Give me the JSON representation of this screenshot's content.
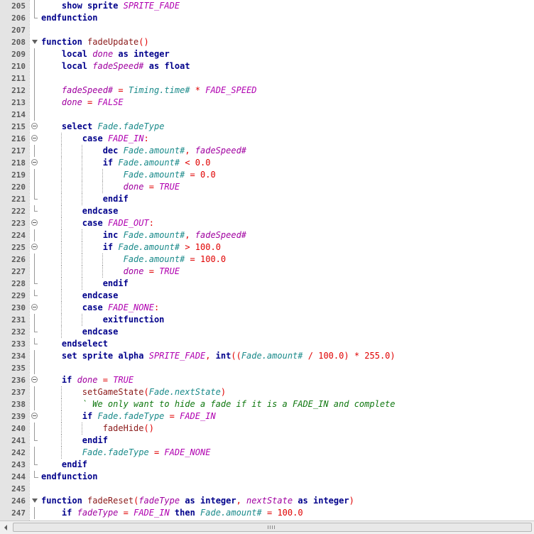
{
  "editor": {
    "lines": [
      {
        "n": "205",
        "fold": "vl",
        "guides": [],
        "code": [
          [
            "    ",
            ""
          ],
          [
            "show sprite",
            "kw"
          ],
          [
            " ",
            ""
          ],
          [
            "SPRITE_FADE",
            "cs"
          ]
        ]
      },
      {
        "n": "206",
        "fold": "end",
        "guides": [],
        "code": [
          [
            "endfunction",
            "kw"
          ]
        ]
      },
      {
        "n": "207",
        "fold": "",
        "guides": [],
        "code": []
      },
      {
        "n": "208",
        "fold": "fn",
        "guides": [],
        "code": [
          [
            "function",
            "kw"
          ],
          [
            " ",
            ""
          ],
          [
            "fadeUpdate",
            "nm"
          ],
          [
            "()",
            "op"
          ]
        ]
      },
      {
        "n": "209",
        "fold": "vl",
        "guides": [],
        "code": [
          [
            "    ",
            ""
          ],
          [
            "local",
            "kw"
          ],
          [
            " ",
            ""
          ],
          [
            "done",
            "va"
          ],
          [
            " ",
            ""
          ],
          [
            "as",
            "kw"
          ],
          [
            " ",
            ""
          ],
          [
            "integer",
            "kw"
          ]
        ]
      },
      {
        "n": "210",
        "fold": "vl",
        "guides": [],
        "code": [
          [
            "    ",
            ""
          ],
          [
            "local",
            "kw"
          ],
          [
            " ",
            ""
          ],
          [
            "fadeSpeed#",
            "va"
          ],
          [
            " ",
            ""
          ],
          [
            "as",
            "kw"
          ],
          [
            " ",
            ""
          ],
          [
            "float",
            "kw"
          ]
        ]
      },
      {
        "n": "211",
        "fold": "vl",
        "guides": [],
        "code": []
      },
      {
        "n": "212",
        "fold": "vl",
        "guides": [],
        "code": [
          [
            "    ",
            ""
          ],
          [
            "fadeSpeed#",
            "va"
          ],
          [
            " ",
            ""
          ],
          [
            "=",
            "op"
          ],
          [
            " ",
            ""
          ],
          [
            "Timing.time#",
            "me"
          ],
          [
            " ",
            ""
          ],
          [
            "*",
            "op"
          ],
          [
            " ",
            ""
          ],
          [
            "FADE_SPEED",
            "cs"
          ]
        ]
      },
      {
        "n": "213",
        "fold": "vl",
        "guides": [],
        "code": [
          [
            "    ",
            ""
          ],
          [
            "done",
            "va"
          ],
          [
            " ",
            ""
          ],
          [
            "=",
            "op"
          ],
          [
            " ",
            ""
          ],
          [
            "FALSE",
            "cs"
          ]
        ]
      },
      {
        "n": "214",
        "fold": "vl",
        "guides": [],
        "code": []
      },
      {
        "n": "215",
        "fold": "box",
        "guides": [],
        "code": [
          [
            "    ",
            ""
          ],
          [
            "select",
            "kw"
          ],
          [
            " ",
            ""
          ],
          [
            "Fade.fadeType",
            "me"
          ]
        ]
      },
      {
        "n": "216",
        "fold": "box",
        "guides": [
          4
        ],
        "code": [
          [
            "        ",
            ""
          ],
          [
            "case",
            "kw"
          ],
          [
            " ",
            ""
          ],
          [
            "FADE_IN",
            "cs"
          ],
          [
            ":",
            "op"
          ]
        ]
      },
      {
        "n": "217",
        "fold": "vl",
        "guides": [
          4,
          8
        ],
        "code": [
          [
            "            ",
            ""
          ],
          [
            "dec",
            "kw"
          ],
          [
            " ",
            ""
          ],
          [
            "Fade.amount#",
            "me"
          ],
          [
            ", ",
            "op"
          ],
          [
            "fadeSpeed#",
            "va"
          ]
        ]
      },
      {
        "n": "218",
        "fold": "box",
        "guides": [
          4,
          8
        ],
        "code": [
          [
            "            ",
            ""
          ],
          [
            "if",
            "kw"
          ],
          [
            " ",
            ""
          ],
          [
            "Fade.amount#",
            "me"
          ],
          [
            " ",
            ""
          ],
          [
            "<",
            "op"
          ],
          [
            " ",
            ""
          ],
          [
            "0.0",
            "num"
          ]
        ]
      },
      {
        "n": "219",
        "fold": "vl",
        "guides": [
          4,
          8,
          12
        ],
        "code": [
          [
            "                ",
            ""
          ],
          [
            "Fade.amount#",
            "me"
          ],
          [
            " ",
            ""
          ],
          [
            "=",
            "op"
          ],
          [
            " ",
            ""
          ],
          [
            "0.0",
            "num"
          ]
        ]
      },
      {
        "n": "220",
        "fold": "vl",
        "guides": [
          4,
          8,
          12
        ],
        "code": [
          [
            "                ",
            ""
          ],
          [
            "done",
            "va"
          ],
          [
            " ",
            ""
          ],
          [
            "=",
            "op"
          ],
          [
            " ",
            ""
          ],
          [
            "TRUE",
            "cs"
          ]
        ]
      },
      {
        "n": "221",
        "fold": "end",
        "guides": [
          4,
          8
        ],
        "code": [
          [
            "            ",
            ""
          ],
          [
            "endif",
            "kw"
          ]
        ]
      },
      {
        "n": "222",
        "fold": "end",
        "guides": [
          4
        ],
        "code": [
          [
            "        ",
            ""
          ],
          [
            "endcase",
            "kw"
          ]
        ]
      },
      {
        "n": "223",
        "fold": "box",
        "guides": [
          4
        ],
        "code": [
          [
            "        ",
            ""
          ],
          [
            "case",
            "kw"
          ],
          [
            " ",
            ""
          ],
          [
            "FADE_OUT",
            "cs"
          ],
          [
            ":",
            "op"
          ]
        ]
      },
      {
        "n": "224",
        "fold": "vl",
        "guides": [
          4,
          8
        ],
        "code": [
          [
            "            ",
            ""
          ],
          [
            "inc",
            "kw"
          ],
          [
            " ",
            ""
          ],
          [
            "Fade.amount#",
            "me"
          ],
          [
            ", ",
            "op"
          ],
          [
            "fadeSpeed#",
            "va"
          ]
        ]
      },
      {
        "n": "225",
        "fold": "box",
        "guides": [
          4,
          8
        ],
        "code": [
          [
            "            ",
            ""
          ],
          [
            "if",
            "kw"
          ],
          [
            " ",
            ""
          ],
          [
            "Fade.amount#",
            "me"
          ],
          [
            " ",
            ""
          ],
          [
            ">",
            "op"
          ],
          [
            " ",
            ""
          ],
          [
            "100.0",
            "num"
          ]
        ]
      },
      {
        "n": "226",
        "fold": "vl",
        "guides": [
          4,
          8,
          12
        ],
        "code": [
          [
            "                ",
            ""
          ],
          [
            "Fade.amount#",
            "me"
          ],
          [
            " ",
            ""
          ],
          [
            "=",
            "op"
          ],
          [
            " ",
            ""
          ],
          [
            "100.0",
            "num"
          ]
        ]
      },
      {
        "n": "227",
        "fold": "vl",
        "guides": [
          4,
          8,
          12
        ],
        "code": [
          [
            "                ",
            ""
          ],
          [
            "done",
            "va"
          ],
          [
            " ",
            ""
          ],
          [
            "=",
            "op"
          ],
          [
            " ",
            ""
          ],
          [
            "TRUE",
            "cs"
          ]
        ]
      },
      {
        "n": "228",
        "fold": "end",
        "guides": [
          4,
          8
        ],
        "code": [
          [
            "            ",
            ""
          ],
          [
            "endif",
            "kw"
          ]
        ]
      },
      {
        "n": "229",
        "fold": "end",
        "guides": [
          4
        ],
        "code": [
          [
            "        ",
            ""
          ],
          [
            "endcase",
            "kw"
          ]
        ]
      },
      {
        "n": "230",
        "fold": "box",
        "guides": [
          4
        ],
        "code": [
          [
            "        ",
            ""
          ],
          [
            "case",
            "kw"
          ],
          [
            " ",
            ""
          ],
          [
            "FADE_NONE",
            "cs"
          ],
          [
            ":",
            "op"
          ]
        ]
      },
      {
        "n": "231",
        "fold": "vl",
        "guides": [
          4,
          8
        ],
        "code": [
          [
            "            ",
            ""
          ],
          [
            "exitfunction",
            "kw"
          ]
        ]
      },
      {
        "n": "232",
        "fold": "end",
        "guides": [
          4
        ],
        "code": [
          [
            "        ",
            ""
          ],
          [
            "endcase",
            "kw"
          ]
        ]
      },
      {
        "n": "233",
        "fold": "end",
        "guides": [],
        "code": [
          [
            "    ",
            ""
          ],
          [
            "endselect",
            "kw"
          ]
        ]
      },
      {
        "n": "234",
        "fold": "vl",
        "guides": [],
        "code": [
          [
            "    ",
            ""
          ],
          [
            "set sprite alpha",
            "kw"
          ],
          [
            " ",
            ""
          ],
          [
            "SPRITE_FADE",
            "cs"
          ],
          [
            ", ",
            "op"
          ],
          [
            "int",
            "kw"
          ],
          [
            "((",
            "op"
          ],
          [
            "Fade.amount#",
            "me"
          ],
          [
            " ",
            ""
          ],
          [
            "/",
            "op"
          ],
          [
            " ",
            ""
          ],
          [
            "100.0",
            "num"
          ],
          [
            ")",
            "op"
          ],
          [
            " ",
            ""
          ],
          [
            "*",
            "op"
          ],
          [
            " ",
            ""
          ],
          [
            "255.0",
            "num"
          ],
          [
            ")",
            "op"
          ]
        ]
      },
      {
        "n": "235",
        "fold": "vl",
        "guides": [],
        "code": []
      },
      {
        "n": "236",
        "fold": "box",
        "guides": [],
        "code": [
          [
            "    ",
            ""
          ],
          [
            "if",
            "kw"
          ],
          [
            " ",
            ""
          ],
          [
            "done",
            "va"
          ],
          [
            " ",
            ""
          ],
          [
            "=",
            "op"
          ],
          [
            " ",
            ""
          ],
          [
            "TRUE",
            "cs"
          ]
        ]
      },
      {
        "n": "237",
        "fold": "vl",
        "guides": [
          4
        ],
        "code": [
          [
            "        ",
            ""
          ],
          [
            "setGameState",
            "fn2"
          ],
          [
            "(",
            "op"
          ],
          [
            "Fade.nextState",
            "me"
          ],
          [
            ")",
            "op"
          ]
        ]
      },
      {
        "n": "238",
        "fold": "vl",
        "guides": [
          4
        ],
        "code": [
          [
            "        ",
            ""
          ],
          [
            "` We only want to hide a fade if it is a FADE_IN and complete",
            "cm"
          ]
        ]
      },
      {
        "n": "239",
        "fold": "box",
        "guides": [
          4
        ],
        "code": [
          [
            "        ",
            ""
          ],
          [
            "if",
            "kw"
          ],
          [
            " ",
            ""
          ],
          [
            "Fade.fadeType",
            "me"
          ],
          [
            " ",
            ""
          ],
          [
            "=",
            "op"
          ],
          [
            " ",
            ""
          ],
          [
            "FADE_IN",
            "cs"
          ]
        ]
      },
      {
        "n": "240",
        "fold": "vl",
        "guides": [
          4,
          8
        ],
        "code": [
          [
            "            ",
            ""
          ],
          [
            "fadeHide",
            "fn2"
          ],
          [
            "()",
            "op"
          ]
        ]
      },
      {
        "n": "241",
        "fold": "end",
        "guides": [
          4
        ],
        "code": [
          [
            "        ",
            ""
          ],
          [
            "endif",
            "kw"
          ]
        ]
      },
      {
        "n": "242",
        "fold": "vl",
        "guides": [
          4
        ],
        "code": [
          [
            "        ",
            ""
          ],
          [
            "Fade.fadeType",
            "me"
          ],
          [
            " ",
            ""
          ],
          [
            "=",
            "op"
          ],
          [
            " ",
            ""
          ],
          [
            "FADE_NONE",
            "cs"
          ]
        ]
      },
      {
        "n": "243",
        "fold": "end",
        "guides": [],
        "code": [
          [
            "    ",
            ""
          ],
          [
            "endif",
            "kw"
          ]
        ]
      },
      {
        "n": "244",
        "fold": "end2",
        "guides": [],
        "code": [
          [
            "endfunction",
            "kw"
          ]
        ]
      },
      {
        "n": "245",
        "fold": "",
        "guides": [],
        "code": []
      },
      {
        "n": "246",
        "fold": "fn",
        "guides": [],
        "code": [
          [
            "function",
            "kw"
          ],
          [
            " ",
            ""
          ],
          [
            "fadeReset",
            "nm"
          ],
          [
            "(",
            "op"
          ],
          [
            "fadeType",
            "va"
          ],
          [
            " ",
            ""
          ],
          [
            "as",
            "kw"
          ],
          [
            " ",
            ""
          ],
          [
            "integer",
            "kw"
          ],
          [
            ", ",
            "op"
          ],
          [
            "nextState",
            "va"
          ],
          [
            " ",
            ""
          ],
          [
            "as",
            "kw"
          ],
          [
            " ",
            ""
          ],
          [
            "integer",
            "kw"
          ],
          [
            ")",
            "op"
          ]
        ]
      },
      {
        "n": "247",
        "fold": "vl",
        "guides": [],
        "code": [
          [
            "    ",
            ""
          ],
          [
            "if",
            "kw"
          ],
          [
            " ",
            ""
          ],
          [
            "fadeType",
            "va"
          ],
          [
            " ",
            ""
          ],
          [
            "=",
            "op"
          ],
          [
            " ",
            ""
          ],
          [
            "FADE_IN",
            "cs"
          ],
          [
            " ",
            ""
          ],
          [
            "then",
            "kw"
          ],
          [
            " ",
            ""
          ],
          [
            "Fade.amount#",
            "me"
          ],
          [
            " ",
            ""
          ],
          [
            "=",
            "op"
          ],
          [
            " ",
            ""
          ],
          [
            "100.0",
            "num"
          ]
        ]
      }
    ]
  },
  "scrollbar": {
    "grip_icon": "grip-icon"
  }
}
